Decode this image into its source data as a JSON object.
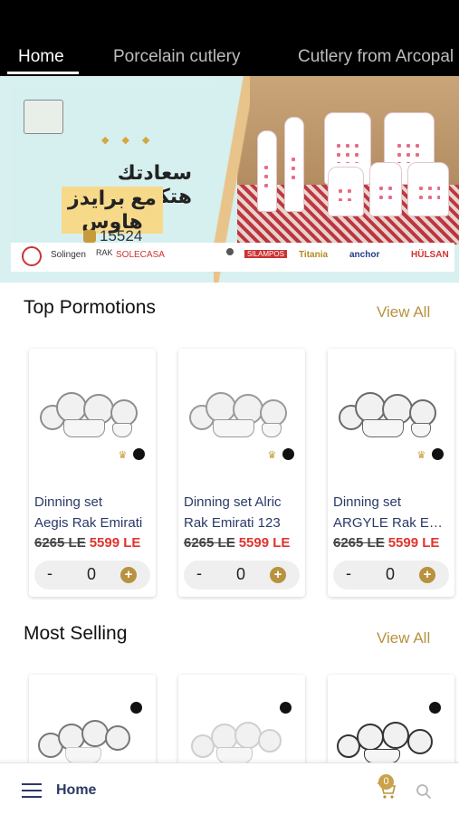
{
  "tabs": [
    {
      "label": "Home",
      "active": true
    },
    {
      "label": "Porcelain cutlery",
      "active": false
    },
    {
      "label": "Cutlery from Arcopal",
      "active": false
    }
  ],
  "banner": {
    "arabic_line1": "سعادتك هتكمل",
    "arabic_line2": "مع برايدز هاوس",
    "phone": "15524",
    "brands": [
      "Solingen",
      "RAK",
      "SOLECASA",
      "SILAMPOS",
      "Titania",
      "anchor",
      "HÜLSAN"
    ]
  },
  "top_promotions": {
    "title": "Top Pormotions",
    "view_all": "View All",
    "products": [
      {
        "name_line1": "Dinning set",
        "name_line2": "Aegis Rak Emirati",
        "old_price": "6265 LE",
        "new_price": "5599 LE",
        "qty": "0"
      },
      {
        "name_line1": "Dinning set Alric",
        "name_line2": "Rak Emirati 123",
        "old_price": "6265 LE",
        "new_price": "5599 LE",
        "qty": "0"
      },
      {
        "name_line1": "Dinning set",
        "name_line2": "ARGYLE Rak Emirati",
        "old_price": "6265 LE",
        "new_price": "5599 LE",
        "qty": "0"
      }
    ]
  },
  "most_selling": {
    "title": "Most Selling",
    "view_all": "View All"
  },
  "qty_controls": {
    "minus": "-",
    "plus": "+"
  },
  "bottom_bar": {
    "label": "Home",
    "cart_count": "0"
  },
  "colors": {
    "accent": "#b8923f",
    "sale": "#e0342e",
    "text_blue": "#2a3a66"
  }
}
